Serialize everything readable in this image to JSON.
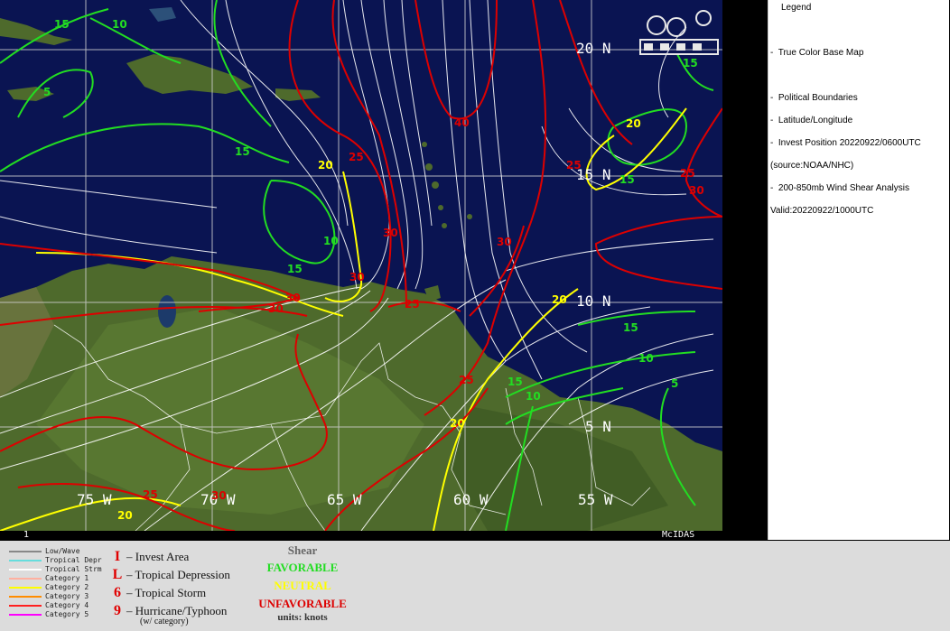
{
  "map": {
    "lat_labels": [
      "20 N",
      "15 N",
      "10 N",
      "5 N"
    ],
    "lon_labels": [
      "75 W",
      "70 W",
      "65 W",
      "60 W",
      "55 W"
    ],
    "contours": {
      "green": [
        "15",
        "10",
        "5",
        "15",
        "10",
        "15",
        "15",
        "15",
        "10",
        "5",
        "15",
        "10",
        "15"
      ],
      "yellow": [
        "20",
        "20",
        "20",
        "20",
        "20"
      ],
      "red": [
        "25",
        "30",
        "40",
        "25",
        "30",
        "30",
        "30",
        "25",
        "30",
        "25",
        "25",
        "30",
        "25",
        "30"
      ]
    },
    "frame_number": "1",
    "system_label": "McIDAS"
  },
  "legend_panel": {
    "title": "Legend",
    "items": [
      "True Color Base Map",
      "Political Boundaries",
      "Latitude/Longitude",
      "Invest Position  20220922/0600UTC",
      "(source:NOAA/NHC)",
      "200-850mb Wind Shear Analysis",
      "Valid:20220922/1000UTC"
    ]
  },
  "key": {
    "track_lines": [
      {
        "label": "Low/Wave",
        "color": "#888888"
      },
      {
        "label": "Tropical Depr",
        "color": "#66dddd"
      },
      {
        "label": "Tropical Strm",
        "color": "#ffffff"
      },
      {
        "label": "Category 1",
        "color": "#ffb0a0"
      },
      {
        "label": "Category 2",
        "color": "#ffff00"
      },
      {
        "label": "Category 3",
        "color": "#ff8c00"
      },
      {
        "label": "Category 4",
        "color": "#ff2020"
      },
      {
        "label": "Category 5",
        "color": "#ff00ff"
      }
    ],
    "symbols": [
      {
        "glyph": "I",
        "label": "– Invest Area"
      },
      {
        "glyph": "L",
        "label": "– Tropical Depression"
      },
      {
        "glyph": "6",
        "label": "– Tropical Storm"
      },
      {
        "glyph": "9",
        "label": "– Hurricane/Typhoon"
      }
    ],
    "symbols_note": "(w/ category)",
    "shear": {
      "title": "Shear",
      "favorable": "FAVORABLE",
      "neutral": "NEUTRAL",
      "unfavorable": "UNFAVORABLE",
      "units": "units: knots"
    },
    "colors": {
      "favorable": "#22dd22",
      "neutral": "#ffff00",
      "unfavorable": "#dd0000"
    }
  }
}
